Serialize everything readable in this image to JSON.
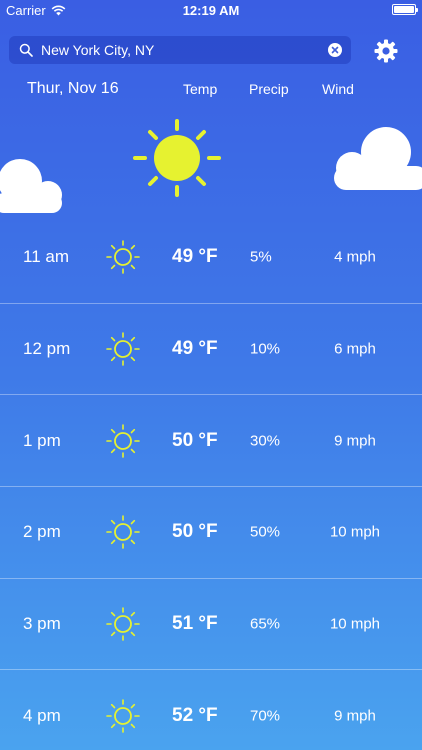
{
  "status": {
    "carrier": "Carrier",
    "time": "12:19 AM"
  },
  "search": {
    "value": "New York City, NY"
  },
  "header": {
    "date": "Thur, Nov 16",
    "temp_label": "Temp",
    "precip_label": "Precip",
    "wind_label": "Wind"
  },
  "icons": {
    "search": "search-icon",
    "clear": "clear-icon",
    "settings": "gear-icon",
    "sun": "sun-icon",
    "cloud": "cloud-icon"
  },
  "colors": {
    "sun": "#e6f230",
    "cloud": "#ffffff"
  },
  "hours": [
    {
      "time": "11 am",
      "temp": "49 °F",
      "precip": "5%",
      "wind": "4 mph"
    },
    {
      "time": "12 pm",
      "temp": "49 °F",
      "precip": "10%",
      "wind": "6 mph"
    },
    {
      "time": "1 pm",
      "temp": "50 °F",
      "precip": "30%",
      "wind": "9 mph"
    },
    {
      "time": "2 pm",
      "temp": "50 °F",
      "precip": "50%",
      "wind": "10 mph"
    },
    {
      "time": "3 pm",
      "temp": "51 °F",
      "precip": "65%",
      "wind": "10 mph"
    },
    {
      "time": "4 pm",
      "temp": "52 °F",
      "precip": "70%",
      "wind": "9 mph"
    }
  ]
}
